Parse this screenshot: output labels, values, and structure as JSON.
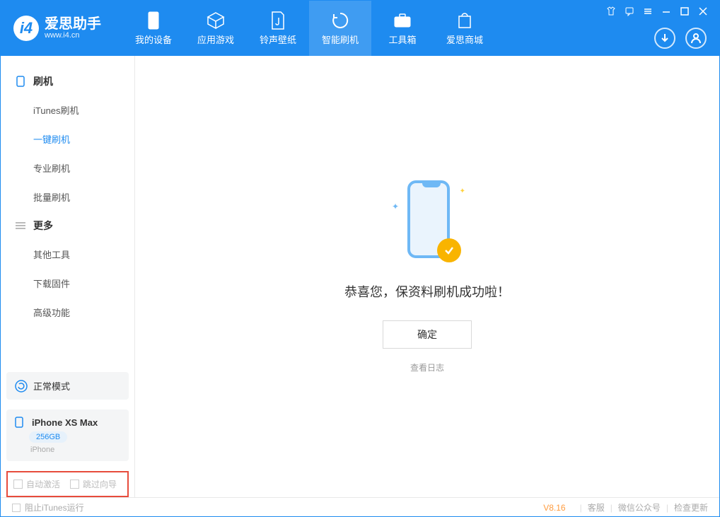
{
  "app": {
    "title": "爱思助手",
    "subtitle": "www.i4.cn"
  },
  "nav": {
    "tabs": [
      {
        "label": "我的设备"
      },
      {
        "label": "应用游戏"
      },
      {
        "label": "铃声壁纸"
      },
      {
        "label": "智能刷机"
      },
      {
        "label": "工具箱"
      },
      {
        "label": "爱思商城"
      }
    ]
  },
  "sidebar": {
    "section1": {
      "title": "刷机",
      "items": [
        "iTunes刷机",
        "一键刷机",
        "专业刷机",
        "批量刷机"
      ]
    },
    "section2": {
      "title": "更多",
      "items": [
        "其他工具",
        "下载固件",
        "高级功能"
      ]
    },
    "status": "正常模式",
    "device": {
      "name": "iPhone XS Max",
      "storage": "256GB",
      "type": "iPhone"
    },
    "checks": {
      "autoActivate": "自动激活",
      "skipGuide": "跳过向导"
    }
  },
  "main": {
    "successText": "恭喜您，保资料刷机成功啦！",
    "okButton": "确定",
    "viewLog": "查看日志"
  },
  "footer": {
    "blockItunes": "阻止iTunes运行",
    "version": "V8.16",
    "links": [
      "客服",
      "微信公众号",
      "检查更新"
    ]
  }
}
